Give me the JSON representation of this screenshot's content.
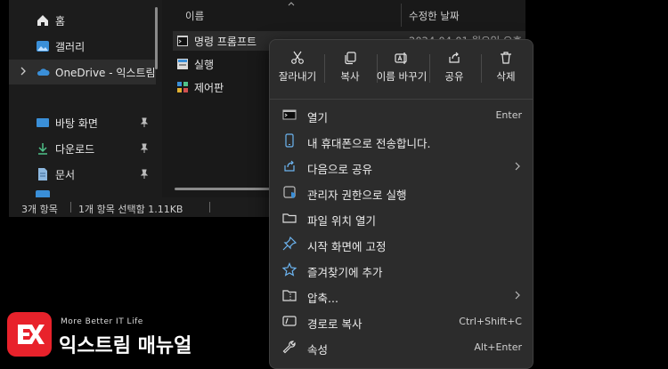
{
  "nav": {
    "items": [
      {
        "label": "홈"
      },
      {
        "label": "갤러리"
      },
      {
        "label": "OneDrive - 익스트림"
      },
      {
        "label": "바탕 화면"
      },
      {
        "label": "다운로드"
      },
      {
        "label": "문서"
      }
    ]
  },
  "content": {
    "columns": {
      "name": "이름",
      "date": "수정한 날짜"
    },
    "files": [
      {
        "name": "명령 프롬프트",
        "date": "2024-04-01 월요일 오후"
      },
      {
        "name": "실행",
        "date": ""
      },
      {
        "name": "제어판",
        "date": ""
      }
    ]
  },
  "status": {
    "count": "3개 항목",
    "selection": "1개 항목 선택함 1.11KB"
  },
  "menu": {
    "toolbar": [
      {
        "label": "잘라내기",
        "icon": "scissors-icon"
      },
      {
        "label": "복사",
        "icon": "copy-icon"
      },
      {
        "label": "이름 바꾸기",
        "icon": "rename-icon"
      },
      {
        "label": "공유",
        "icon": "share-icon"
      },
      {
        "label": "삭제",
        "icon": "trash-icon"
      }
    ],
    "items": [
      {
        "label": "열기",
        "shortcut": "Enter",
        "icon": "terminal-icon"
      },
      {
        "label": "내 휴대폰으로 전송합니다.",
        "shortcut": "",
        "icon": "phone-icon"
      },
      {
        "label": "다음으로 공유",
        "shortcut": "",
        "icon": "share-icon"
      },
      {
        "label": "관리자 권한으로 실행",
        "shortcut": "",
        "icon": "shield-icon"
      },
      {
        "label": "파일 위치 열기",
        "shortcut": "",
        "icon": "folder-icon"
      },
      {
        "label": "시작 화면에 고정",
        "shortcut": "",
        "icon": "pin-icon"
      },
      {
        "label": "즐겨찾기에 추가",
        "shortcut": "",
        "icon": "star-icon"
      },
      {
        "label": "압축...",
        "shortcut": "",
        "icon": "zip-icon"
      },
      {
        "label": "경로로 복사",
        "shortcut": "Ctrl+Shift+C",
        "icon": "path-icon"
      },
      {
        "label": "속성",
        "shortcut": "Alt+Enter",
        "icon": "wrench-icon"
      }
    ]
  },
  "logo": {
    "sub": "More Better IT Life",
    "main": "익스트림 매뉴얼"
  },
  "colors": {
    "accent": "#3a8fd8",
    "logo": "#e8222b",
    "menu_bg": "#2c2c2c"
  }
}
